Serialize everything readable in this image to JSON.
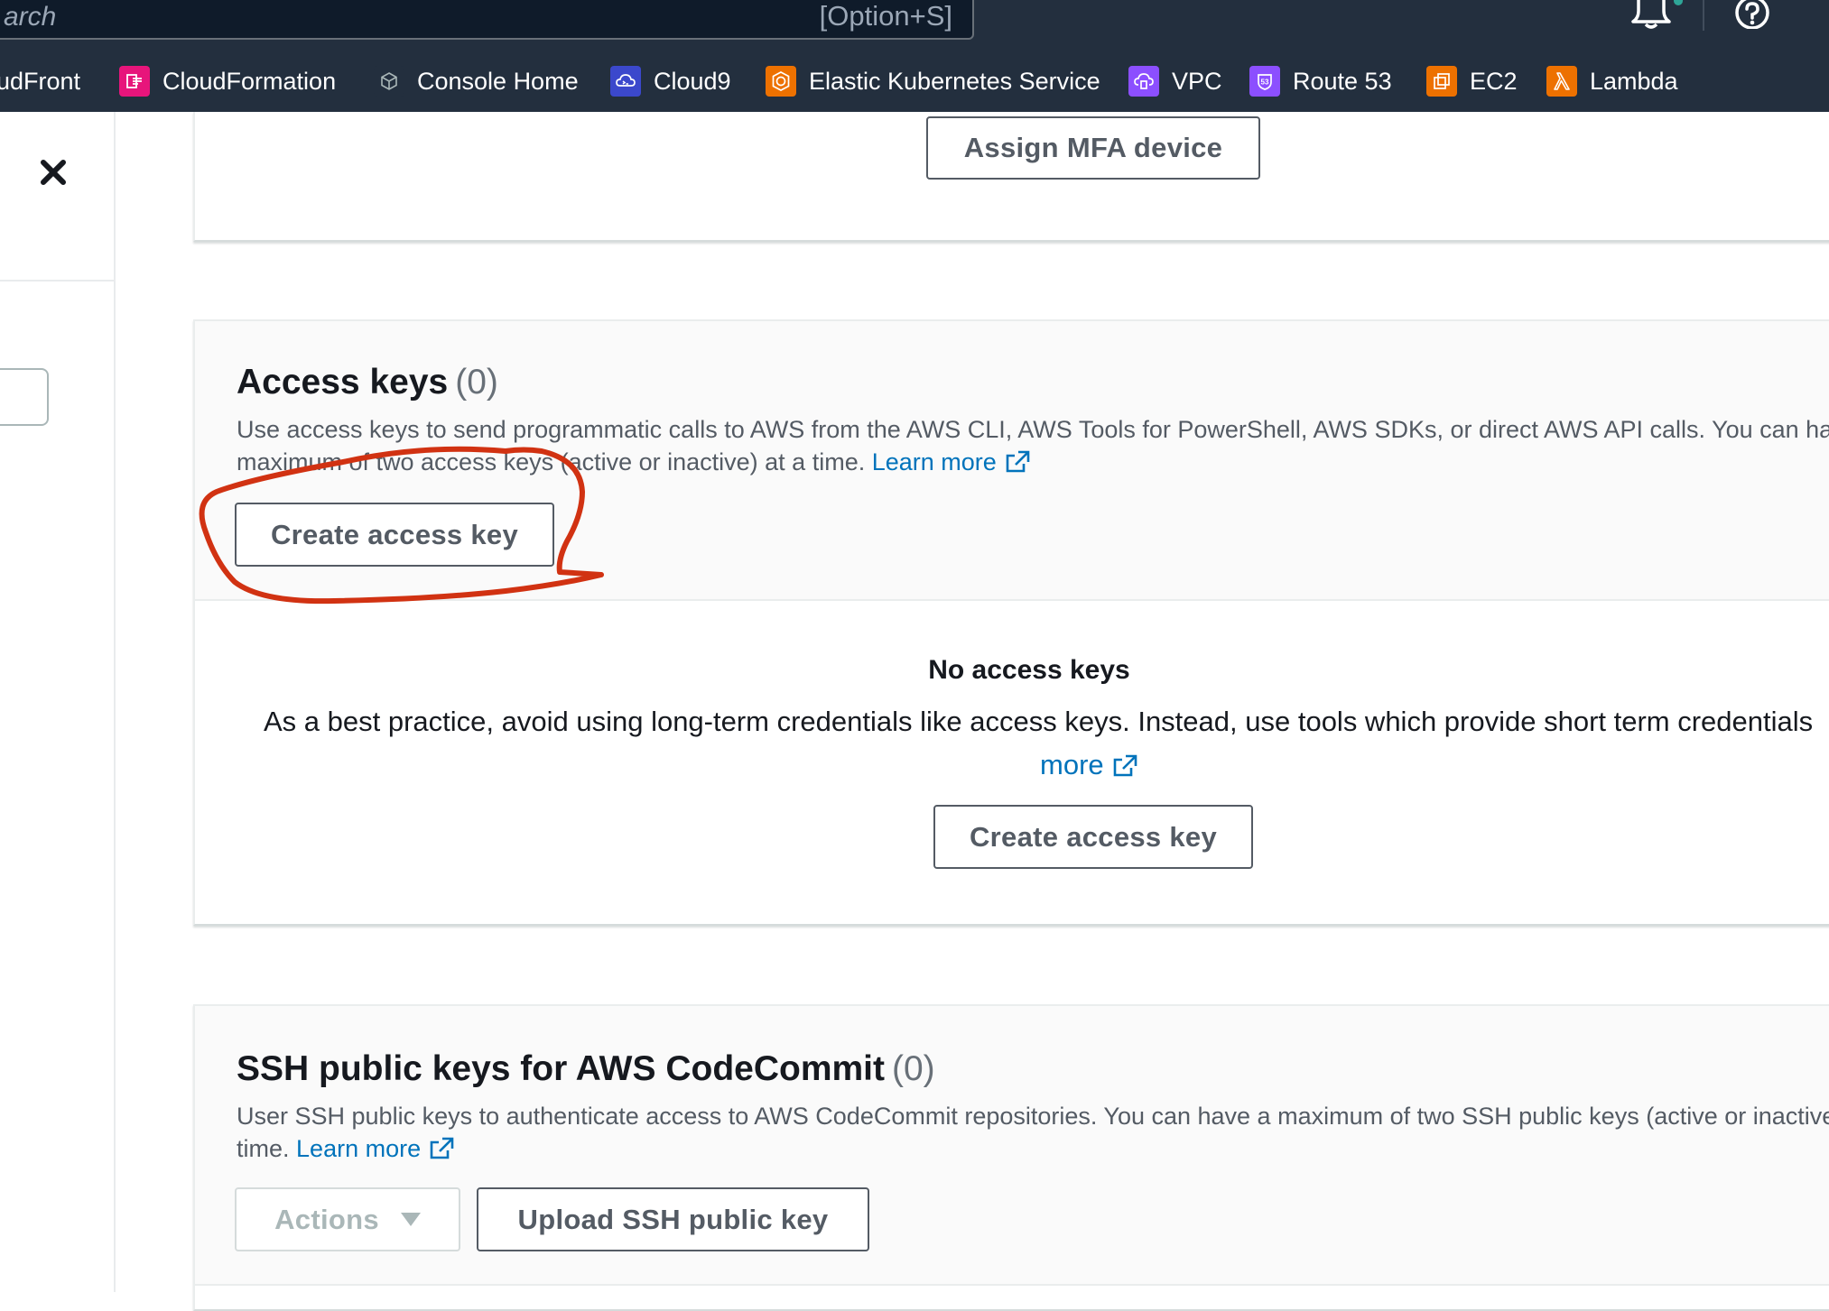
{
  "topbar": {
    "search_placeholder": "arch",
    "search_shortcut": "[Option+S]",
    "favorites": [
      {
        "label": "udFront",
        "icon": "cloudfront-icon",
        "color": "#232f3e"
      },
      {
        "label": "CloudFormation",
        "icon": "cloudformation-icon",
        "color": "#e7157b"
      },
      {
        "label": "Console Home",
        "icon": "console-home-icon",
        "color": "#232f3e"
      },
      {
        "label": "Cloud9",
        "icon": "cloud9-icon",
        "color": "#3b48cc"
      },
      {
        "label": "Elastic Kubernetes Service",
        "icon": "eks-icon",
        "color": "#ed7100"
      },
      {
        "label": "VPC",
        "icon": "vpc-icon",
        "color": "#8c4fff"
      },
      {
        "label": "Route 53",
        "icon": "route53-icon",
        "color": "#8c4fff"
      },
      {
        "label": "EC2",
        "icon": "ec2-icon",
        "color": "#ed7100"
      },
      {
        "label": "Lambda",
        "icon": "lambda-icon",
        "color": "#ed7100"
      }
    ]
  },
  "mfa": {
    "button_label": "Assign MFA device"
  },
  "access_keys": {
    "title": "Access keys",
    "count": "(0)",
    "description_line1": "Use access keys to send programmatic calls to AWS from the AWS CLI, AWS Tools for PowerShell, AWS SDKs, or direct AWS API calls. You can have",
    "description_line2": "maximum of two access keys (active or inactive) at a time.",
    "learn_more": "Learn more",
    "create_button": "Create access key",
    "empty_title": "No access keys",
    "empty_description": "As a best practice, avoid using long-term credentials like access keys. Instead, use tools which provide short term credentials",
    "empty_more": "more",
    "empty_create_button": "Create access key"
  },
  "ssh_keys": {
    "title": "SSH public keys for AWS CodeCommit",
    "count": "(0)",
    "description_line1": "User SSH public keys to authenticate access to AWS CodeCommit repositories. You can have a maximum of two SSH public keys (active or inactive)",
    "description_line2": "time.",
    "learn_more": "Learn more",
    "actions_button": "Actions",
    "upload_button": "Upload SSH public key"
  },
  "colors": {
    "nav_background": "#232f3e",
    "link": "#0073bb",
    "annotation": "#d13212"
  }
}
